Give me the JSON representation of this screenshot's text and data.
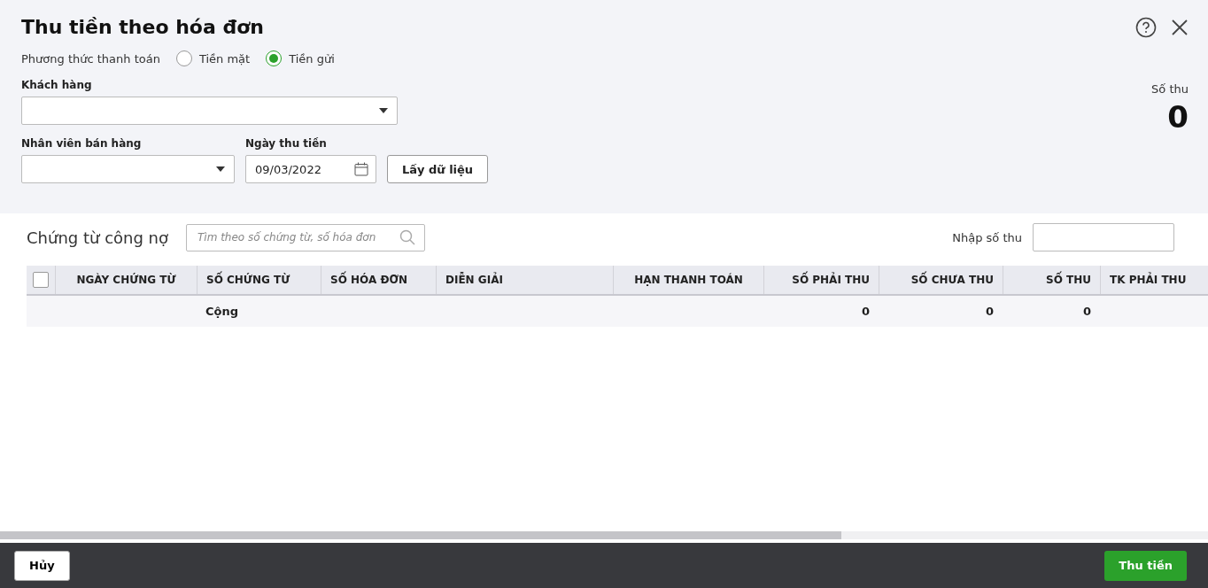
{
  "dialog": {
    "title": "Thu tiền theo hóa đơn"
  },
  "payment_method": {
    "label": "Phương thức thanh toán",
    "options": [
      {
        "label": "Tiền mặt",
        "selected": false
      },
      {
        "label": "Tiền gửi",
        "selected": true
      }
    ]
  },
  "customer": {
    "label": "Khách hàng"
  },
  "salesperson": {
    "label": "Nhân viên bán hàng"
  },
  "receipt_date": {
    "label": "Ngày thu tiền",
    "value": "09/03/2022"
  },
  "fetch_button": "Lấy dữ liệu",
  "receipt_total": {
    "label": "Số thu",
    "value": "0"
  },
  "documents": {
    "title": "Chứng từ công nợ",
    "search_placeholder": "Tìm theo số chứng từ, số hóa đơn",
    "amount_label": "Nhập số thu"
  },
  "table": {
    "all_checked": false,
    "columns": [
      "NGÀY CHỨNG TỪ",
      "SỐ CHỨNG TỪ",
      "SỐ HÓA ĐƠN",
      "DIỄN GIẢI",
      "HẠN THANH TOÁN",
      "SỐ PHẢI THU",
      "SỐ CHƯA THU",
      "SỐ THU",
      "TK PHẢI THU"
    ],
    "totals": {
      "label": "Cộng",
      "amounts": [
        "0",
        "0",
        "0"
      ]
    }
  },
  "footer": {
    "cancel": "Hủy",
    "submit": "Thu tiền"
  }
}
